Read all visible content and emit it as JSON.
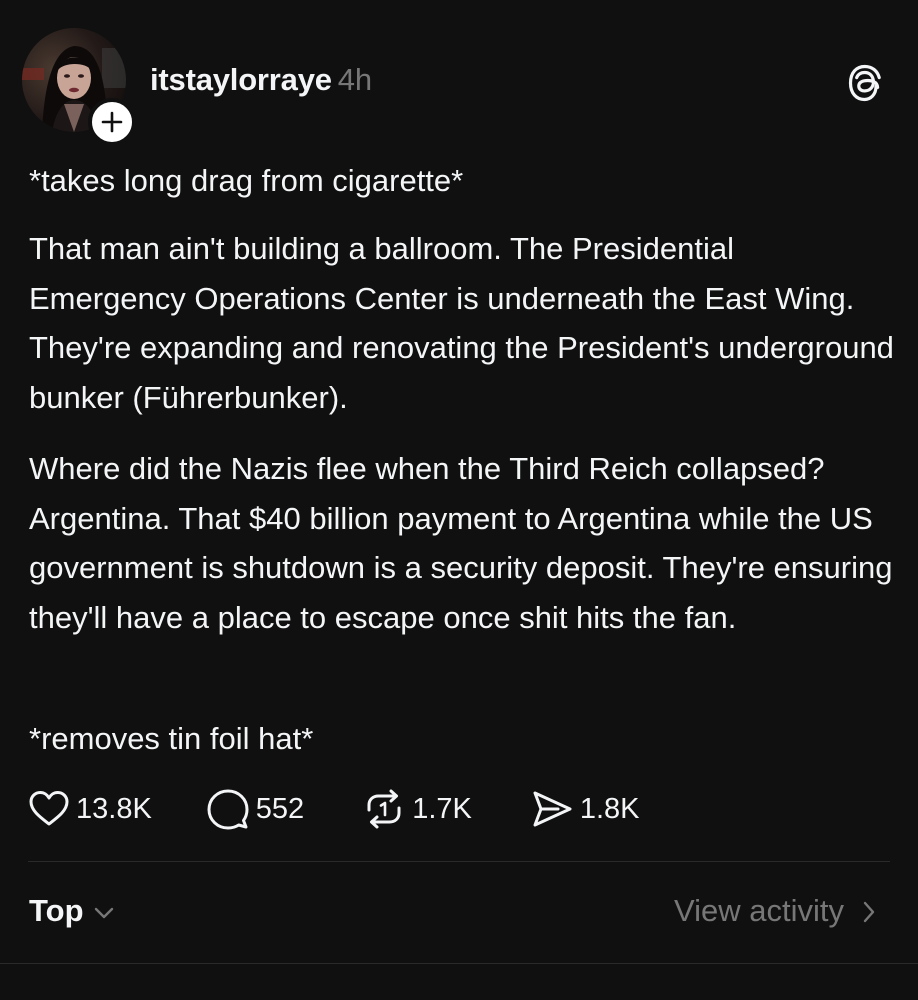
{
  "post": {
    "username": "itstaylorraye",
    "timestamp": "4h",
    "paragraphs": [
      "*takes long drag from cigarette*",
      "That man ain't building a ballroom. The Presidential Emergency Operations Center is underneath the East Wing. They're expanding and renovating the President's underground bunker (Führerbunker).",
      "Where did the Nazis flee when the Third Reich collapsed? Argentina. That $40 billion payment to Argentina while the US government is shutdown is a security deposit. They're ensuring they'll have a place to escape once shit hits the fan.",
      "*removes tin foil hat*"
    ]
  },
  "actions": {
    "likes": "13.8K",
    "replies": "552",
    "reposts": "1.7K",
    "shares": "1.8K"
  },
  "footer": {
    "sort_label": "Top",
    "view_activity_label": "View activity"
  },
  "icons": {
    "follow": "plus-icon",
    "app": "threads-logo-icon",
    "like": "heart-icon",
    "reply": "speech-bubble-icon",
    "repost": "repost-icon",
    "share": "send-icon",
    "sort": "chevron-down-icon",
    "activity": "chevron-right-icon"
  },
  "colors": {
    "background": "#101010",
    "primary_text": "#f3f5f7",
    "secondary_text": "#777777",
    "divider": "#2a2a2a"
  }
}
